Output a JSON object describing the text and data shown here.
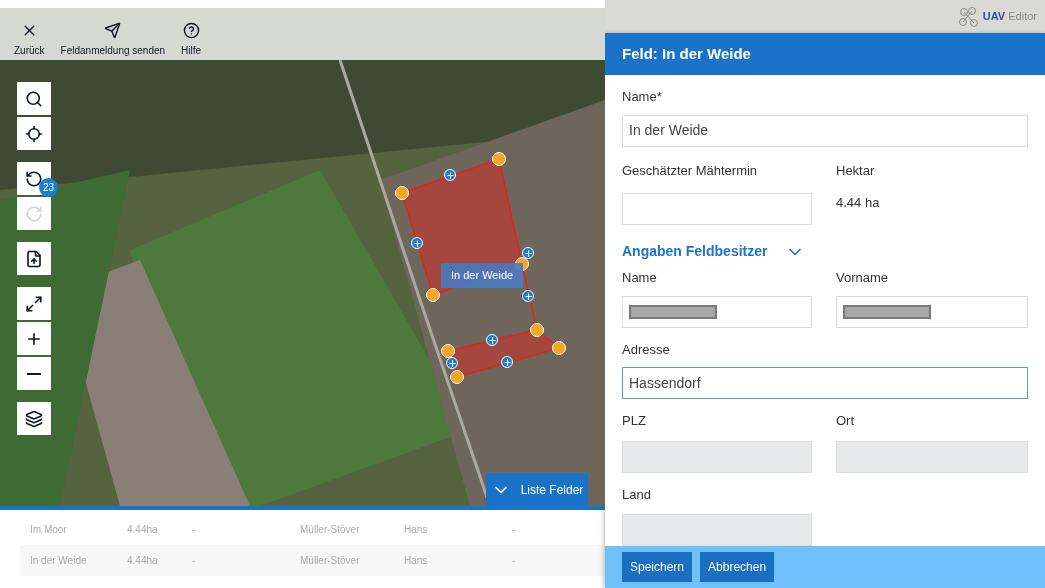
{
  "toolbar": [
    {
      "kind": "close",
      "label": "Zurück"
    },
    {
      "kind": "send",
      "label": "Feldanmeldung senden"
    },
    {
      "kind": "help",
      "label": "Hilfe"
    }
  ],
  "map_controls": [
    {
      "kind": "search",
      "disabled": false
    },
    {
      "kind": "locate",
      "disabled": false
    },
    {
      "kind": "undo",
      "disabled": false,
      "badge": "23"
    },
    {
      "kind": "redo",
      "disabled": true
    },
    {
      "kind": "shp",
      "disabled": false
    },
    {
      "kind": "fullscreen",
      "disabled": false
    },
    {
      "kind": "zoom_in",
      "disabled": false
    },
    {
      "kind": "zoom_out",
      "disabled": false
    },
    {
      "kind": "layers",
      "disabled": false
    }
  ],
  "map": {
    "field_label": "In der Weide"
  },
  "list_button": {
    "label": "Liste Felder"
  },
  "table": {
    "rows": [
      {
        "cells": [
          "Im Moor",
          "4.44ha",
          "-",
          "Müller-Stöver",
          "Hans",
          "-"
        ]
      },
      {
        "cells": [
          "In der Weide",
          "4.44ha",
          "-",
          "Müller-Stöver",
          "Hans",
          "-"
        ]
      }
    ]
  },
  "logo": {
    "brand": "UAV",
    "product": "Editor"
  },
  "panel": {
    "title": "Feld: In der Weide",
    "name_label": "Name*",
    "name_value": "In der Weide",
    "date_label": "Geschätzter Mähtermin",
    "hectare_label": "Hektar",
    "hectare_value": "4.44 ha",
    "owner_section": {
      "title": "Angaben Feldbesitzer",
      "expanded": true
    },
    "owner_name_label": "Name",
    "owner_firstname_label": "Vorname",
    "address_label": "Adresse",
    "address_value": "Hassendorf",
    "zip_label": "PLZ",
    "city_label": "Ort",
    "country_label": "Land",
    "buttons": [
      "Speichern",
      "Abbrechen"
    ]
  }
}
